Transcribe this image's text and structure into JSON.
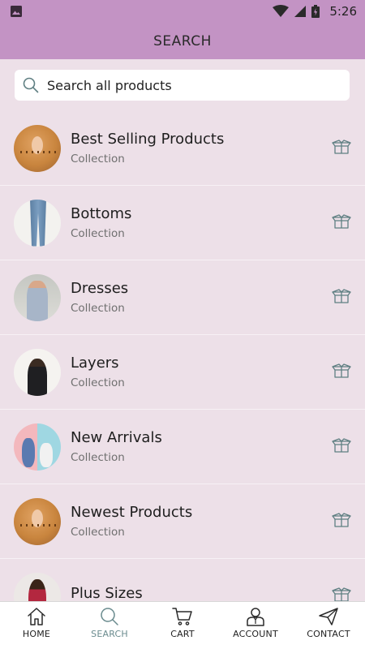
{
  "status_bar": {
    "time": "5:26",
    "icons": [
      "image-icon",
      "wifi-icon",
      "signal-icon",
      "battery-icon"
    ]
  },
  "app_bar": {
    "title": "SEARCH",
    "color": "#c393c4"
  },
  "search": {
    "placeholder": "Search all products"
  },
  "collections": [
    {
      "title": "Best Selling Products",
      "subtitle": "Collection",
      "thumb": "orange-blouse"
    },
    {
      "title": "Bottoms",
      "subtitle": "Collection",
      "thumb": "jeans"
    },
    {
      "title": "Dresses",
      "subtitle": "Collection",
      "thumb": "floral-dress"
    },
    {
      "title": "Layers",
      "subtitle": "Collection",
      "thumb": "leather-jacket"
    },
    {
      "title": "New Arrivals",
      "subtitle": "Collection",
      "thumb": "new-arrivals-graphic"
    },
    {
      "title": "Newest Products",
      "subtitle": "Collection",
      "thumb": "orange-blouse"
    },
    {
      "title": "Plus Sizes",
      "subtitle": "",
      "thumb": "red-top"
    }
  ],
  "bottom_nav": {
    "items": [
      {
        "label": "HOME",
        "icon": "home-icon",
        "active": false
      },
      {
        "label": "SEARCH",
        "icon": "search-icon",
        "active": true
      },
      {
        "label": "CART",
        "icon": "cart-icon",
        "active": false
      },
      {
        "label": "ACCOUNT",
        "icon": "account-icon",
        "active": false
      },
      {
        "label": "CONTACT",
        "icon": "send-icon",
        "active": false
      }
    ],
    "active_color": "#6a8b8e"
  },
  "colors": {
    "background": "#ede0e8",
    "accent": "#c393c4",
    "icon": "#5f7f82"
  }
}
